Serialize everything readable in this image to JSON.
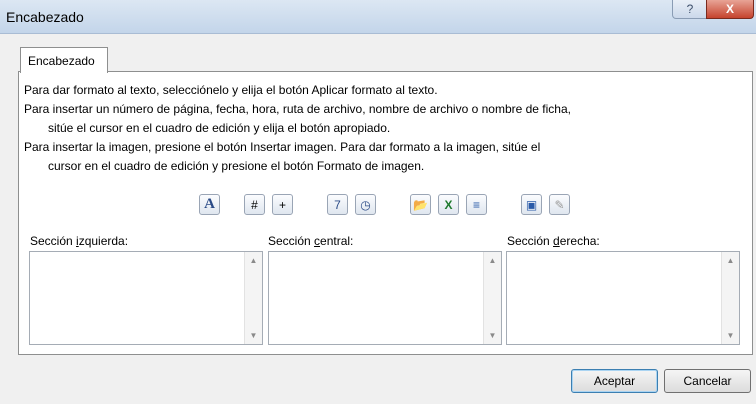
{
  "window": {
    "title": "Encabezado",
    "help_label": "?",
    "close_label": "X"
  },
  "tab": {
    "label": "Encabezado"
  },
  "instructions": [
    "Para dar formato al texto, selecciónelo y elija el botón Aplicar formato al texto.",
    "Para insertar un número de página, fecha, hora, ruta de archivo, nombre de archivo o nombre de ficha,",
    "sitúe el cursor en el cuadro de edición y elija el botón apropiado.",
    "Para insertar la imagen, presione el botón Insertar imagen. Para dar formato a la imagen, sitúe el",
    "cursor en el cuadro de edición y presione el botón Formato de imagen."
  ],
  "toolbar": [
    {
      "icon": "format-text-icon",
      "glyph": "A"
    },
    {
      "icon": "page-number-icon",
      "glyph": "#"
    },
    {
      "icon": "page-count-icon",
      "glyph": "+"
    },
    {
      "icon": "date-icon",
      "glyph": "7"
    },
    {
      "icon": "time-icon",
      "glyph": "◷"
    },
    {
      "icon": "file-path-icon",
      "glyph": "📂"
    },
    {
      "icon": "file-name-icon",
      "glyph": "X"
    },
    {
      "icon": "sheet-name-icon",
      "glyph": "≡"
    },
    {
      "icon": "insert-picture-icon",
      "glyph": "▣"
    },
    {
      "icon": "format-picture-icon",
      "glyph": "✎"
    }
  ],
  "sections": {
    "left": {
      "pre": "Sección ",
      "key": "i",
      "post": "zquierda:"
    },
    "center": {
      "pre": "Sección ",
      "key": "c",
      "post": "entral:"
    },
    "right": {
      "pre": "Sección ",
      "key": "d",
      "post": "erecha:"
    }
  },
  "buttons": {
    "ok": "Aceptar",
    "cancel": "Cancelar"
  }
}
